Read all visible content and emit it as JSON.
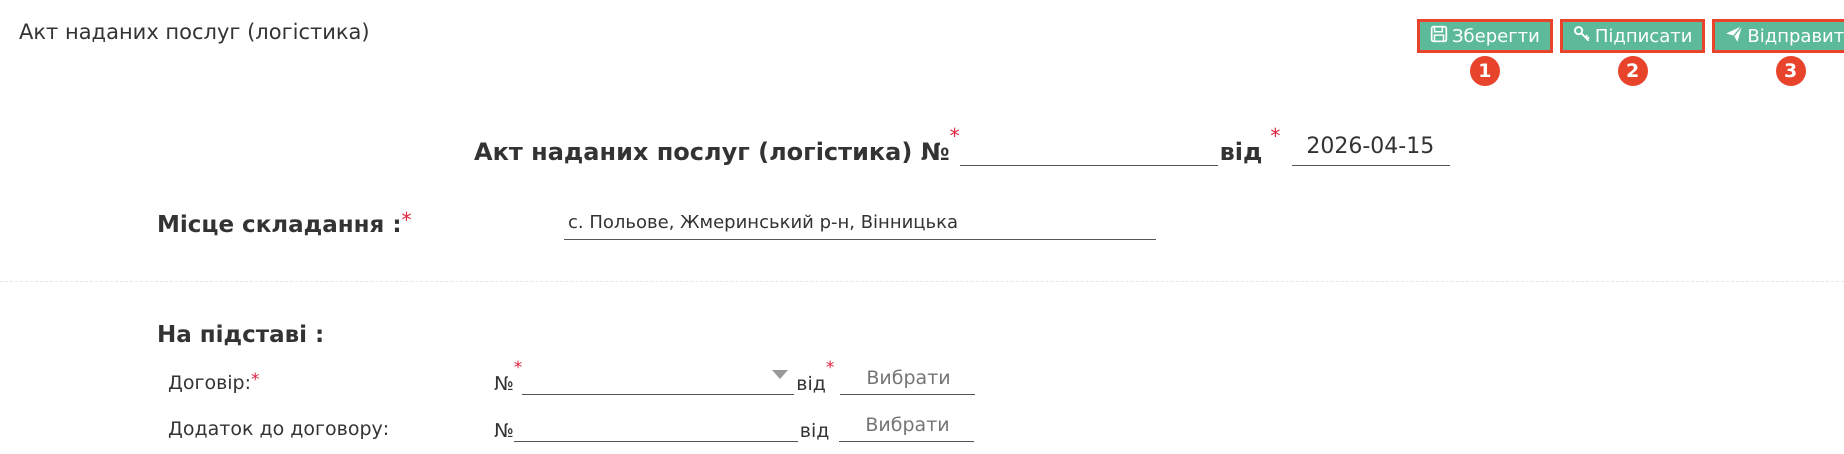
{
  "header": {
    "title": "Акт наданих послуг (логістика)"
  },
  "toolbar": {
    "save_label": "Зберегти",
    "sign_label": "Підписати",
    "send_label": "Відправити",
    "badges": [
      "1",
      "2",
      "3"
    ],
    "button_color": "#5cb99a",
    "highlight_color": "#e8432b"
  },
  "document": {
    "heading": "Акт наданих послуг (логістика) №",
    "number_value": "",
    "from_label": "від",
    "date_value": "2026-04-15",
    "required_mark": "*"
  },
  "place": {
    "label": "Місце складання :",
    "value": "с. Польове, Жмеринський р-н, Вінницька"
  },
  "basis": {
    "heading": "На підставі :",
    "contract": {
      "label": "Договір:",
      "number_prefix": "№",
      "number_value": "",
      "from_label": "від",
      "date_placeholder": "Вибрати"
    },
    "addendum": {
      "label": "Додаток до договору:",
      "number_prefix": "№",
      "number_value": "",
      "from_label": "від",
      "date_placeholder": "Вибрати"
    }
  }
}
